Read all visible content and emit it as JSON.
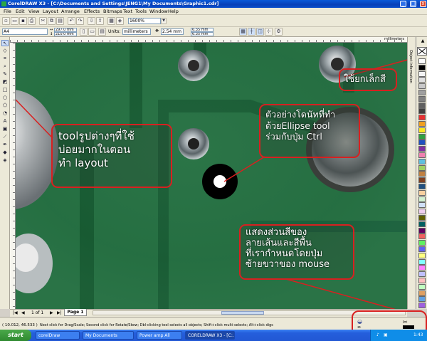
{
  "window": {
    "title": "CorelDRAW X3 - [C:\\Documents and Settings\\JENG1\\My Documents\\Graphic1.cdr]",
    "minimize": "_",
    "maximize": "□",
    "close": "x"
  },
  "menu": [
    "File",
    "Edit",
    "View",
    "Layout",
    "Arrange",
    "Effects",
    "Bitmaps",
    "Text",
    "Tools",
    "Window",
    "Help"
  ],
  "toolbar": {
    "zoom": "1600%",
    "page_size": "A4",
    "width": "297.0 mm",
    "height": "210.0 mm",
    "units_label": "Units:",
    "units": "millimeters",
    "nudge": "2.54 mm",
    "dup_x": "6.35 mm",
    "dup_y": "6.35 mm"
  },
  "ruler": {
    "unit": "millimeters"
  },
  "docker": {
    "label": "Object Information"
  },
  "palette_colors": [
    "#ffffff",
    "#000000",
    "#f4f4f4",
    "#e0e0e0",
    "#c8c8c8",
    "#a0a0a0",
    "#808080",
    "#606060",
    "#404040",
    "#e83030",
    "#f0a020",
    "#f8e820",
    "#30a040",
    "#2050c0",
    "#8030a0",
    "#f080b0",
    "#60c0e0",
    "#a0d060",
    "#c08040",
    "#804020",
    "#205080",
    "#f8d0a0",
    "#d0f0d0",
    "#d0e0f8",
    "#f0d0f0",
    "#606000",
    "#006060",
    "#600060",
    "#f06060",
    "#60f060",
    "#6060f0",
    "#ffff80",
    "#80ffff",
    "#ff80ff",
    "#c0c0ff",
    "#ffc0c0",
    "#c0ffc0",
    "#e0a060",
    "#60a0e0",
    "#a060e0"
  ],
  "page_nav": {
    "count": "1 of 1",
    "page_tab": "Page 1"
  },
  "status": {
    "coords": "( 10.012, 46.533 )",
    "hint": "Next click for Drag/Scale; Second click for Rotate/Skew; Dbl-clicking tool selects all objects; Shift+click multi-selects; Alt+click digs"
  },
  "taskbar": {
    "start": "start",
    "tasks": [
      "corelDraw",
      "My Documents",
      "Power amp All",
      "CORELDRAW X3 - [C:..."
    ],
    "clock": "1:43"
  },
  "annotations": {
    "tools": [
      "toolรูปต่างๆที่ใช้",
      "บ่อยมากในตอน",
      "ทำ layout"
    ],
    "color": [
      "ใช้ยกเล็กสี"
    ],
    "ellipse": [
      "ตัวอย่างโดนัทที่ทำ",
      "ด้วยEllipse tool",
      "ร่วมกับปุ่ม Ctrl"
    ],
    "mouse": [
      "แสดงส่วนสีของ",
      "ลายเส้นและสีพื้น",
      "ที่เรากำหนดโดยปุ่ม",
      "ซ้ายขวาของ mouse"
    ]
  }
}
